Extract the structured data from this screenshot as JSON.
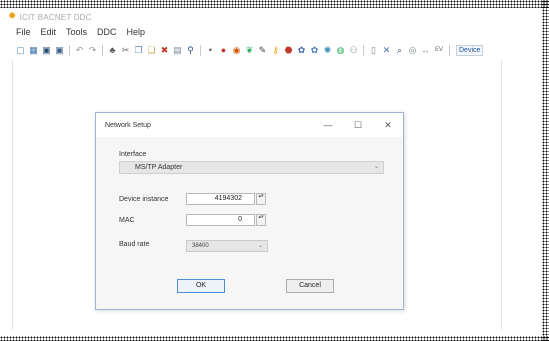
{
  "app": {
    "title": "ICIT BACNET DDC"
  },
  "menu": {
    "file": "File",
    "edit": "Edit",
    "tools": "Tools",
    "ddc": "DDC",
    "help": "Help"
  },
  "toolbar": {
    "icons": [
      {
        "name": "new-icon",
        "glyph": "▢",
        "color": "#5b7fb4"
      },
      {
        "name": "grid-icon",
        "glyph": "▦",
        "color": "#3b6fb0"
      },
      {
        "name": "save-icon",
        "glyph": "▣",
        "color": "#2f4f7a"
      },
      {
        "name": "save-all-icon",
        "glyph": "▣",
        "color": "#3b5f8a"
      },
      {
        "name": "undo-icon",
        "glyph": "↶",
        "color": "#999999"
      },
      {
        "name": "redo-icon",
        "glyph": "↷",
        "color": "#999999"
      },
      {
        "name": "network-icon",
        "glyph": "♣",
        "color": "#555555"
      },
      {
        "name": "cut-icon",
        "glyph": "✂",
        "color": "#666666"
      },
      {
        "name": "copy-icon",
        "glyph": "❐",
        "color": "#5d86c0"
      },
      {
        "name": "paste-icon",
        "glyph": "❏",
        "color": "#c9a04a"
      },
      {
        "name": "delete-icon",
        "glyph": "✖",
        "color": "#c0392b"
      },
      {
        "name": "table-icon",
        "glyph": "▤",
        "color": "#7a8aa0"
      },
      {
        "name": "search-icon",
        "glyph": "⚲",
        "color": "#2f4f7a"
      },
      {
        "name": "dot-icon",
        "glyph": "•",
        "color": "#555555"
      },
      {
        "name": "record-icon",
        "glyph": "●",
        "color": "#c0392b"
      },
      {
        "name": "circle-icon",
        "glyph": "◉",
        "color": "#d35400"
      },
      {
        "name": "leaf-icon",
        "glyph": "❦",
        "color": "#27ae60"
      },
      {
        "name": "pen-icon",
        "glyph": "✎",
        "color": "#444444"
      },
      {
        "name": "key-icon",
        "glyph": "⚷",
        "color": "#e6a817"
      },
      {
        "name": "lock-icon",
        "glyph": "⬣",
        "color": "#c0392b"
      },
      {
        "name": "gear-icon",
        "glyph": "✿",
        "color": "#4169b5"
      },
      {
        "name": "settings-icon",
        "glyph": "✿",
        "color": "#4a7bc8"
      },
      {
        "name": "refresh-icon",
        "glyph": "✺",
        "color": "#3c8dbc"
      },
      {
        "name": "globe-icon",
        "glyph": "◍",
        "color": "#27ae60"
      },
      {
        "name": "users-icon",
        "glyph": "⚇",
        "color": "#7f8c8d"
      },
      {
        "name": "bar-icon",
        "glyph": "▯",
        "color": "#888888"
      },
      {
        "name": "tools-icon",
        "glyph": "✕",
        "color": "#4a6fa5"
      },
      {
        "name": "zoom-icon",
        "glyph": "⌕",
        "color": "#2f4f7a"
      },
      {
        "name": "target-icon",
        "glyph": "◎",
        "color": "#7f8c8d"
      },
      {
        "name": "expand-icon",
        "glyph": "↔",
        "color": "#888888"
      }
    ],
    "ev_label": "EV",
    "device_label": "Device"
  },
  "dialog": {
    "title": "Network Setup",
    "minimize_glyph": "—",
    "maximize_glyph": "☐",
    "close_glyph": "✕",
    "interface_label": "Interface",
    "interface_value": "MS/TP Adapter",
    "device_instance_label": "Device instance",
    "device_instance_value": "4194302",
    "mac_label": "MAC",
    "mac_value": "0",
    "baud_rate_label": "Baud rate",
    "baud_rate_value": "38400",
    "ok_label": "OK",
    "cancel_label": "Cancel",
    "dropdown_arrow": "⌄",
    "spin_glyph": "▴▾"
  }
}
